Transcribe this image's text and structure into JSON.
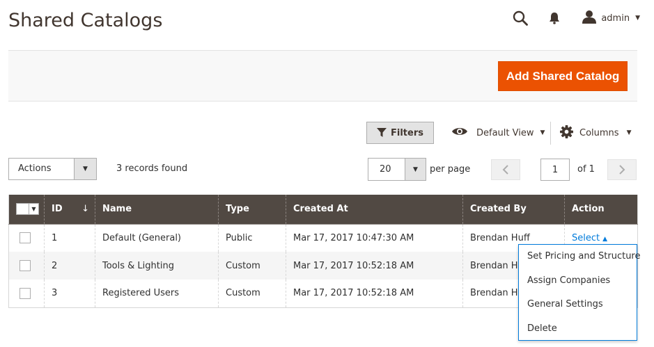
{
  "page": {
    "title": "Shared Catalogs"
  },
  "header": {
    "user_name": "admin",
    "icons": [
      "search-icon",
      "bell-icon",
      "user-icon"
    ]
  },
  "action_bar": {
    "add_button": "Add Shared Catalog"
  },
  "toolbar": {
    "filters_label": "Filters",
    "view_label": "Default View",
    "columns_label": "Columns",
    "actions_label": "Actions",
    "records_found": "3 records found",
    "per_page_value": "20",
    "per_page_label": "per page",
    "current_page": "1",
    "of_pages": "of 1"
  },
  "grid": {
    "columns": [
      "ID",
      "Name",
      "Type",
      "Created At",
      "Created By",
      "Action"
    ],
    "rows": [
      {
        "id": "1",
        "name": "Default (General)",
        "type": "Public",
        "created_at": "Mar 17, 2017 10:47:30 AM",
        "created_by": "Brendan Huff",
        "action": "Select"
      },
      {
        "id": "2",
        "name": "Tools & Lighting",
        "type": "Custom",
        "created_at": "Mar 17, 2017 10:52:18 AM",
        "created_by": "Brendan Hu",
        "action": ""
      },
      {
        "id": "3",
        "name": "Registered Users",
        "type": "Custom",
        "created_at": "Mar 17, 2017 10:52:18 AM",
        "created_by": "Brendan Hu",
        "action": ""
      }
    ]
  },
  "action_menu": {
    "items": [
      "Set Pricing and Structure",
      "Assign Companies",
      "General Settings",
      "Delete"
    ]
  },
  "colors": {
    "accent": "#eb5202",
    "header_bg": "#514943",
    "link": "#007bdb"
  }
}
